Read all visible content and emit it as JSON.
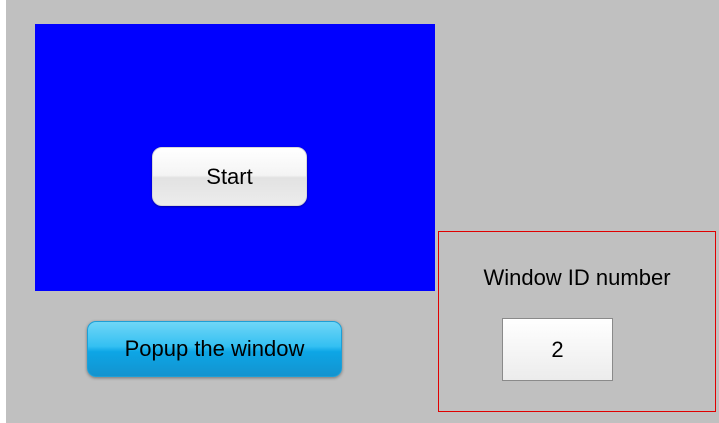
{
  "popup_window": {
    "background_color": "#0000ff",
    "start_button_label": "Start"
  },
  "popup_button": {
    "label": "Popup the window",
    "color": "#1aaee8"
  },
  "window_id": {
    "label": "Window ID number",
    "value": "2",
    "frame_color": "#e00000"
  }
}
